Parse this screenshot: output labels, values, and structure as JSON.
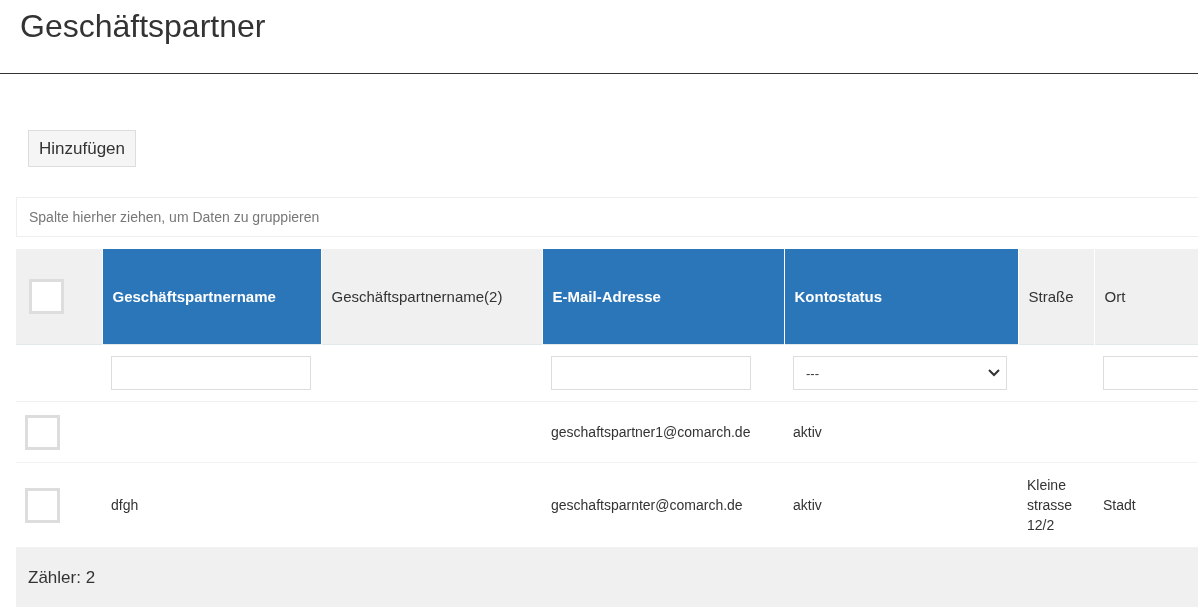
{
  "page": {
    "title": "Geschäftspartner"
  },
  "toolbar": {
    "add_button": "Hinzufügen"
  },
  "group_panel": {
    "placeholder": "Spalte hierher ziehen, um Daten zu gruppieren"
  },
  "table": {
    "select_all": {
      "checked": false
    },
    "columns": [
      {
        "label": "Geschäftspartnername",
        "highlighted": true,
        "filter": {
          "kind": "text"
        }
      },
      {
        "label": "Geschäftspartnername(2)",
        "highlighted": false
      },
      {
        "label": "E-Mail-Adresse",
        "highlighted": true,
        "filter": {
          "kind": "text"
        }
      },
      {
        "label": "Kontostatus",
        "highlighted": true,
        "filter": {
          "kind": "select",
          "value": "---"
        }
      },
      {
        "label": "Straße",
        "highlighted": false
      },
      {
        "label": "Ort",
        "highlighted": false,
        "filter": {
          "kind": "text"
        }
      }
    ],
    "rows": [
      {
        "checked": false,
        "cells": [
          "",
          "",
          "geschaftspartner1@comarch.de",
          "aktiv",
          "",
          ""
        ]
      },
      {
        "checked": false,
        "cells": [
          "dfgh",
          "",
          "geschaftsparnter@comarch.de",
          "aktiv",
          "Kleine strasse 12/2",
          "Stadt"
        ]
      }
    ],
    "footer": "Zähler: 2"
  }
}
